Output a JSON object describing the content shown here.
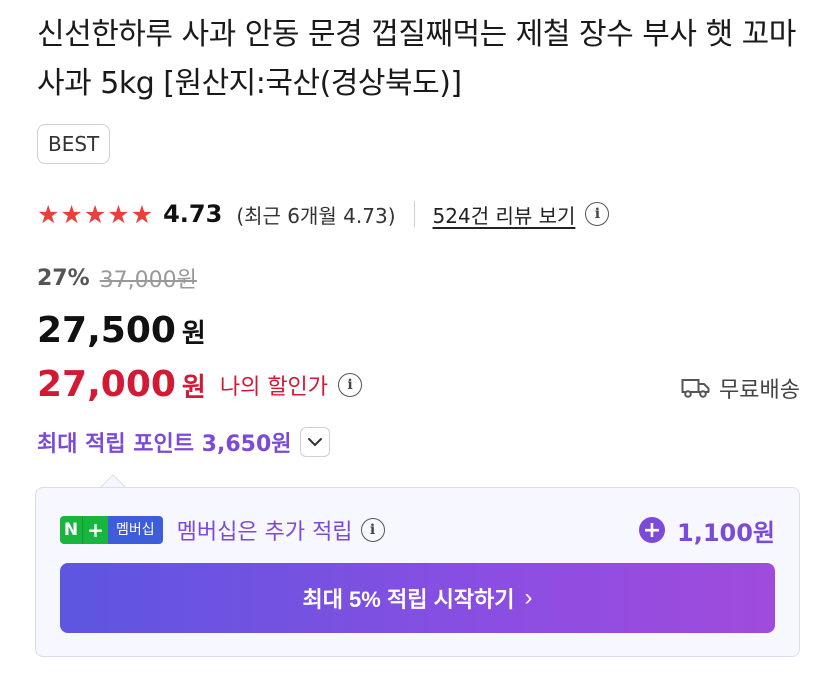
{
  "product": {
    "title": "신선한하루 사과 안동 문경 껍질째먹는 제철 장수 부사 햇 꼬마 사과 5kg [원산지:국산(경상북도)]",
    "badge": "BEST"
  },
  "rating": {
    "stars": 4.73,
    "score": "4.73",
    "recent": "(최근 6개월 4.73)",
    "review_link": "524건 리뷰 보기",
    "star_color": "#e8403a"
  },
  "pricing": {
    "discount_rate": "27%",
    "original_price": "37,000원",
    "price": "27,500",
    "price_unit": "원",
    "my_price": "27,000",
    "my_price_unit": "원",
    "my_price_label": "나의 할인가",
    "accent_red": "#d31a34"
  },
  "shipping": {
    "label": "무료배송",
    "icon": "truck-icon"
  },
  "points": {
    "max_points_text": "최대 적립 포인트 3,650원",
    "accent_purple": "#7b4ad9"
  },
  "membership": {
    "badge_n": "N",
    "badge_plus": "+",
    "badge_label": "멤버십",
    "text": "멤버십은 추가 적립",
    "extra_points": "1,100원",
    "cta_label": "최대 5% 적립 시작하기",
    "cta_chevron": "›"
  },
  "icons": {
    "info": "i",
    "star": "★",
    "plus": "+"
  }
}
